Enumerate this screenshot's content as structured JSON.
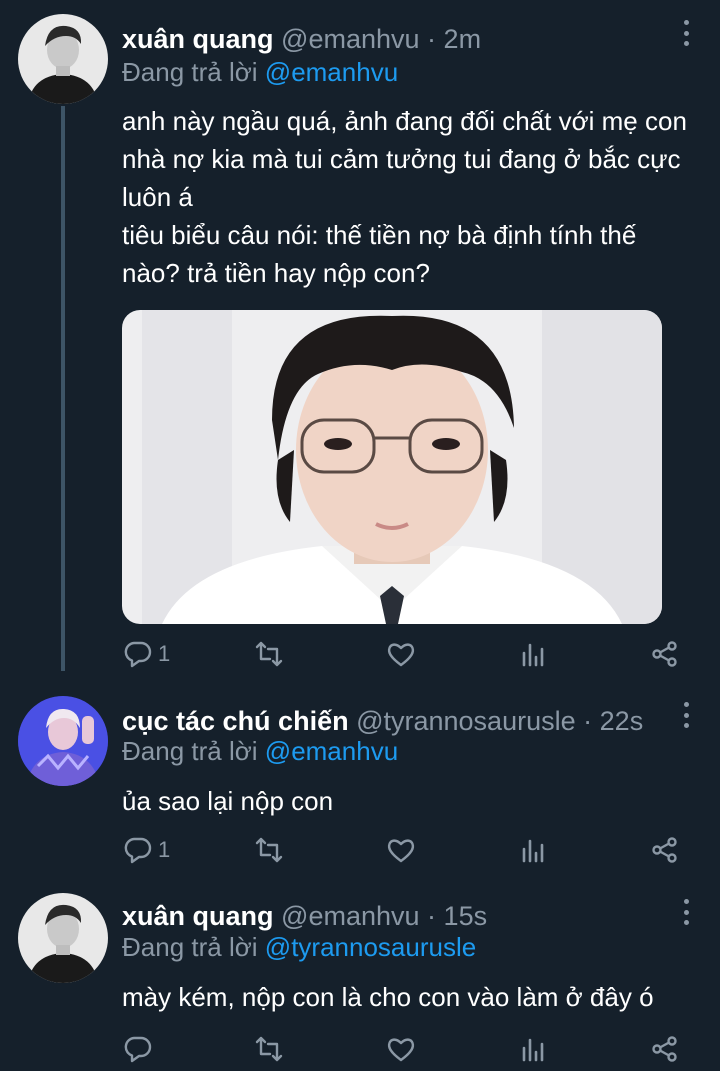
{
  "tweets": [
    {
      "name": "xuân quang",
      "handle": "@emanhvu",
      "separator": "·",
      "time": "2m",
      "reply_prefix": "Đang trả lời",
      "reply_to": "@emanhvu",
      "text_lines": [
        "anh này ngầu quá, ảnh đang đối chất với mẹ con",
        "nhà nợ kia mà tui cảm tưởng tui đang ở bắc cực",
        "luôn á",
        "tiêu biểu câu nói: thế tiền nợ bà định tính thế",
        "nào? trả tiền hay nộp con?"
      ],
      "has_media": true,
      "reply_count": "1"
    },
    {
      "name": "cục tác chú chiến",
      "handle": "@tyrannosaurusle",
      "separator": "·",
      "time": "22s",
      "reply_prefix": "Đang trả lời",
      "reply_to": "@emanhvu",
      "text_lines": [
        "ủa sao lại nộp con"
      ],
      "reply_count": "1"
    },
    {
      "name": "xuân quang",
      "handle": "@emanhvu",
      "separator": "·",
      "time": "15s",
      "reply_prefix": "Đang trả lời",
      "reply_to": "@tyrannosaurusle",
      "text_lines": [
        "mày kém, nộp con là cho con vào làm ở đây ó"
      ],
      "reply_count": ""
    }
  ],
  "colors": {
    "background": "#15202b",
    "secondary_text": "#8b98a5",
    "mention": "#1d9bf0",
    "thread_line": "#3d5466"
  },
  "icons": {
    "reply": "reply-icon",
    "retweet": "retweet-icon",
    "like": "like-icon",
    "analytics": "analytics-icon",
    "share": "share-icon",
    "more": "more-options-icon"
  }
}
